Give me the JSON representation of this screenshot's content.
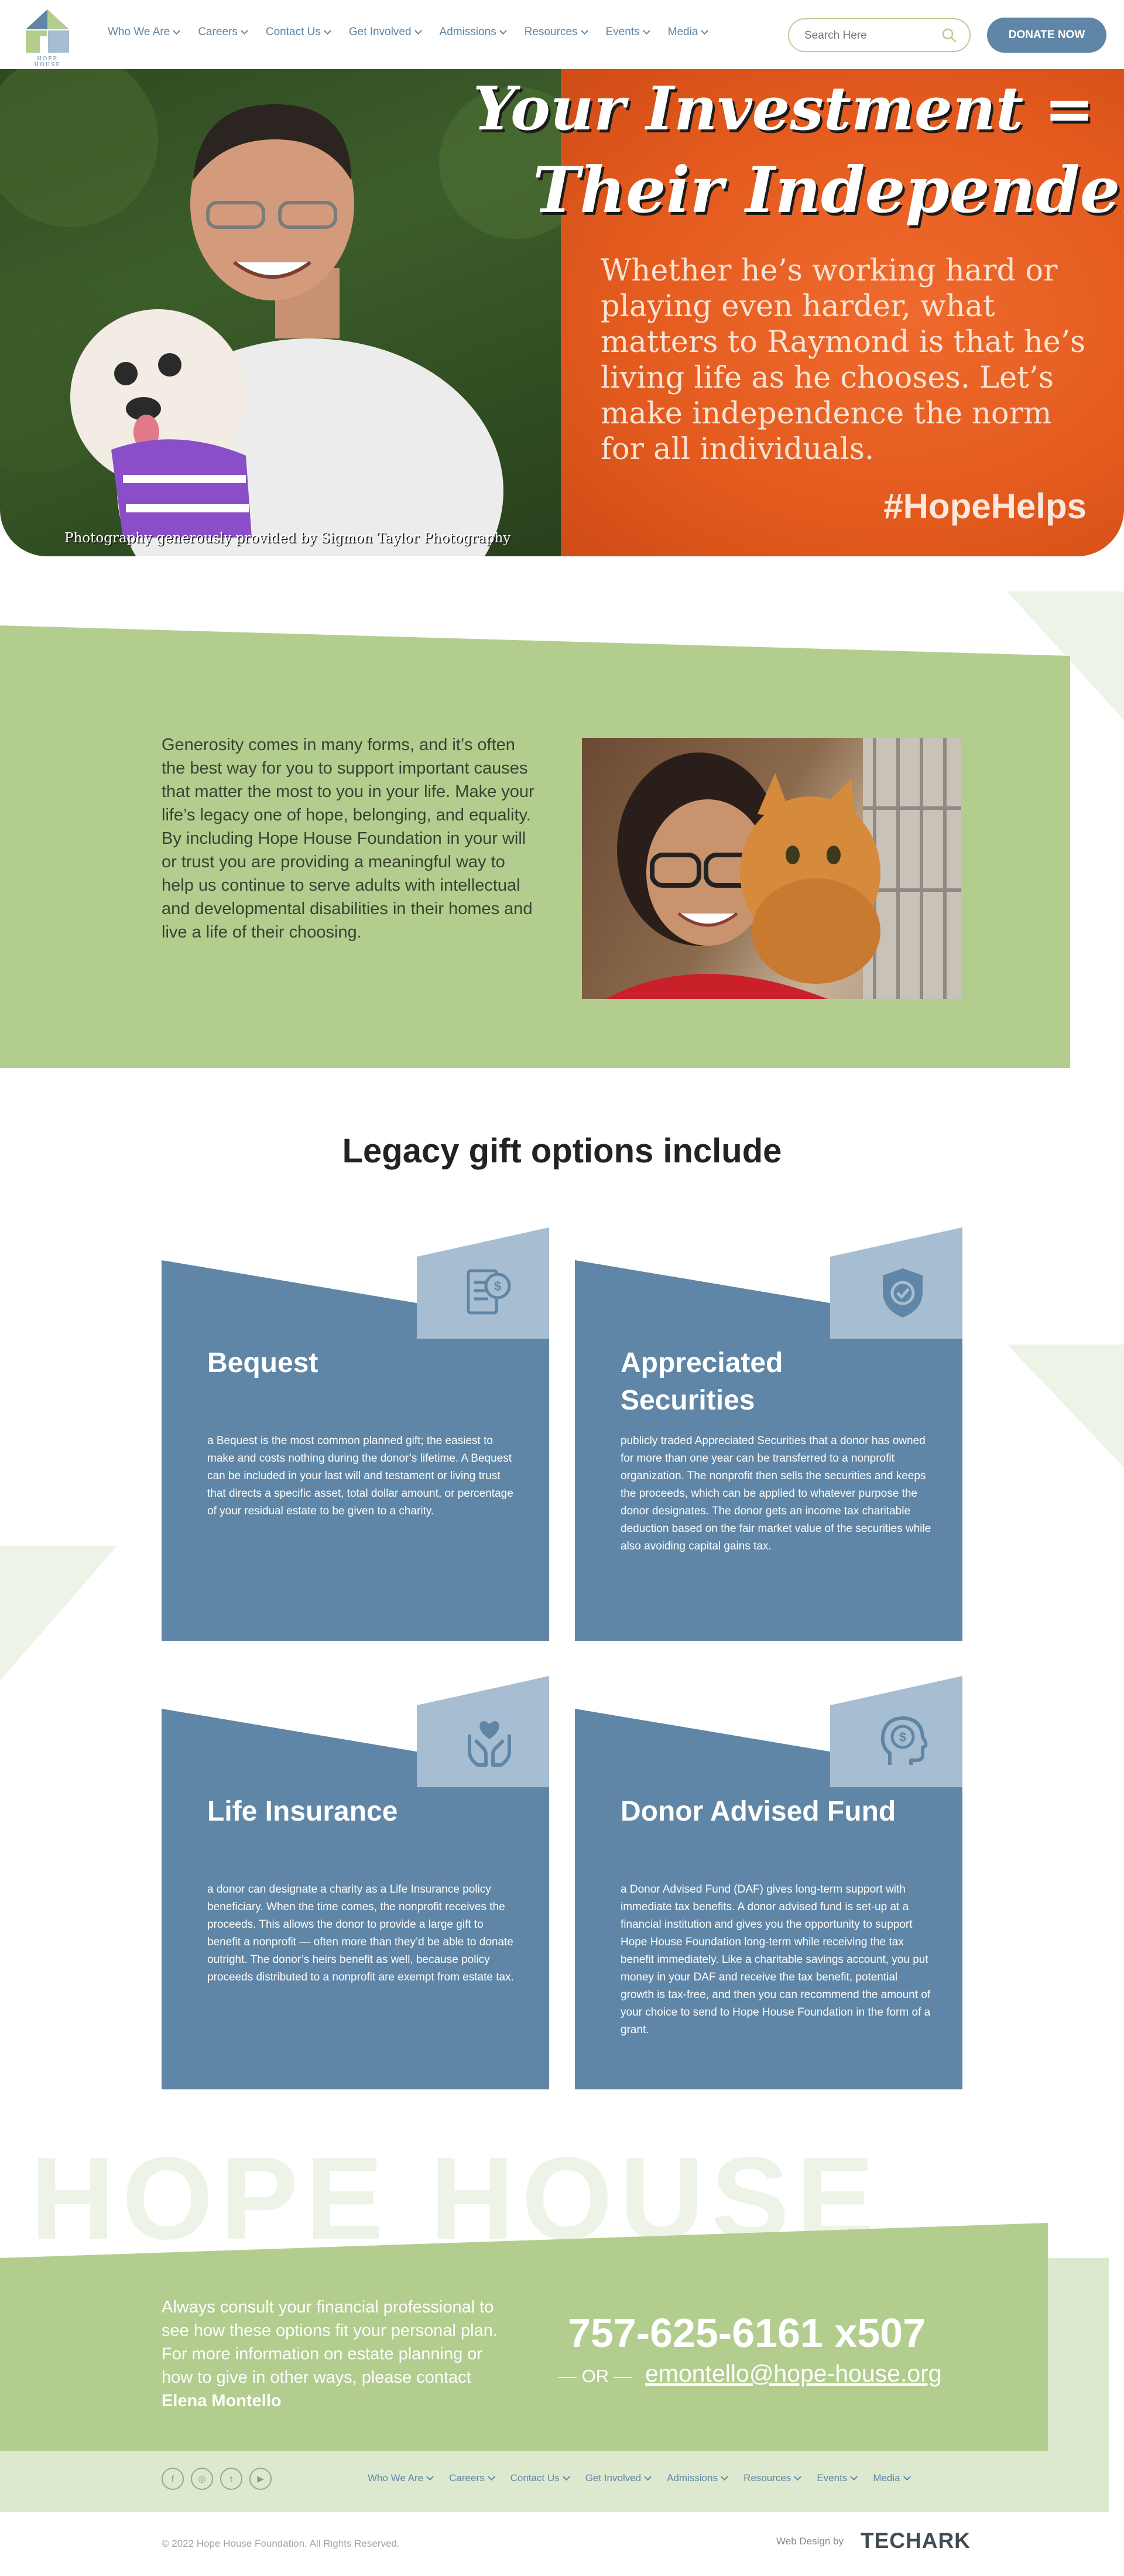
{
  "header": {
    "logo_text": "HOPE HOUSE",
    "nav": [
      {
        "label": "Who We Are"
      },
      {
        "label": "Careers"
      },
      {
        "label": "Contact Us"
      },
      {
        "label": "Get Involved"
      },
      {
        "label": "Admissions"
      },
      {
        "label": "Resources"
      },
      {
        "label": "Events"
      },
      {
        "label": "Media"
      }
    ],
    "search_placeholder": "Search Here",
    "donate_label": "DONATE NOW",
    "colors": {
      "brand_blue": "#5f86a6",
      "brand_green": "#b3cd8f"
    }
  },
  "hero": {
    "title_line1": "Your Investment =",
    "title_line2": "Their Independence",
    "body": "Whether he’s working hard or playing even harder, what matters to Raymond is that he’s living life as he chooses. Let’s make independence the norm for all individuals.",
    "hashtag": "#HopeHelps",
    "credit": "Photography generously provided by Sigmon Taylor Photography",
    "accent_color": "#e35a1e"
  },
  "intro": {
    "text": "Generosity comes in many forms, and it’s often the best way for you to support important causes that matter the most to you in your life. Make your life’s legacy one of hope, belonging, and equality.  By including Hope House Foundation in your will or trust you are providing a meaningful way to help us continue to serve adults with intellectual and developmental disabilities in their homes and live a life of their choosing."
  },
  "legacy": {
    "title": "Legacy gift options include",
    "cards": [
      {
        "icon": "bequest-document-icon",
        "title": "Bequest",
        "text": "a Bequest is the most common planned gift; the easiest to make and costs nothing during the donor’s lifetime. A Bequest can be included in your last will and testament or living trust that directs a specific asset, total dollar amount, or percentage of your residual estate to be given to a charity."
      },
      {
        "icon": "shield-check-icon",
        "title": "Appreciated Securities",
        "text": "publicly traded Appreciated Securities that a donor has owned for more than one year can be transferred to a nonprofit organization. The nonprofit then sells the securities and keeps the proceeds, which can be applied to whatever purpose the donor designates. The donor gets an income tax charitable deduction based on the fair market value of the securities while also avoiding capital gains tax."
      },
      {
        "icon": "hands-heart-icon",
        "title": "Life Insurance",
        "text": "a donor can designate a charity as a Life Insurance policy beneficiary. When the time comes, the nonprofit receives the proceeds. This allows the donor to provide a large gift to benefit a nonprofit — often more than they’d be able to donate outright. The donor’s heirs benefit as well, because policy proceeds distributed to a nonprofit are exempt from estate tax."
      },
      {
        "icon": "head-dollar-icon",
        "title": "Donor Advised Fund",
        "text": "a Donor Advised Fund (DAF) gives long-term support with immediate tax benefits.  A donor advised fund is set-up at a financial institution and gives you the opportunity to support Hope House Foundation long-term while receiving the tax benefit immediately.  Like a charitable savings account, you put money in your DAF and receive the tax benefit, potential growth is tax-free, and then you can recommend the amount of your choice to send to Hope House Foundation in the form of a grant."
      }
    ]
  },
  "contact": {
    "watermark": "HOPE HOUSE",
    "text": "Always consult your financial professional to see how these options fit your personal plan.  For more information on estate planning or how to give in other ways, please contact",
    "contact_name": "Elena Montello",
    "phone": "757-625-6161 x507",
    "or_label": "— OR —",
    "email": "emontello@hope-house.org"
  },
  "footer": {
    "socials": [
      {
        "icon": "facebook-icon",
        "glyph": "f"
      },
      {
        "icon": "instagram-icon",
        "glyph": "◎"
      },
      {
        "icon": "twitter-icon",
        "glyph": "t"
      },
      {
        "icon": "youtube-icon",
        "glyph": "▶"
      }
    ],
    "nav": [
      {
        "label": "Who We Are"
      },
      {
        "label": "Careers"
      },
      {
        "label": "Contact Us"
      },
      {
        "label": "Get Involved"
      },
      {
        "label": "Admissions"
      },
      {
        "label": "Resources"
      },
      {
        "label": "Events"
      },
      {
        "label": "Media"
      }
    ],
    "copyright": "© 2022 Hope House Foundation. All Rights Reserved.",
    "web_design_label": "Web Design by",
    "web_design_brand": "TECHARK"
  }
}
